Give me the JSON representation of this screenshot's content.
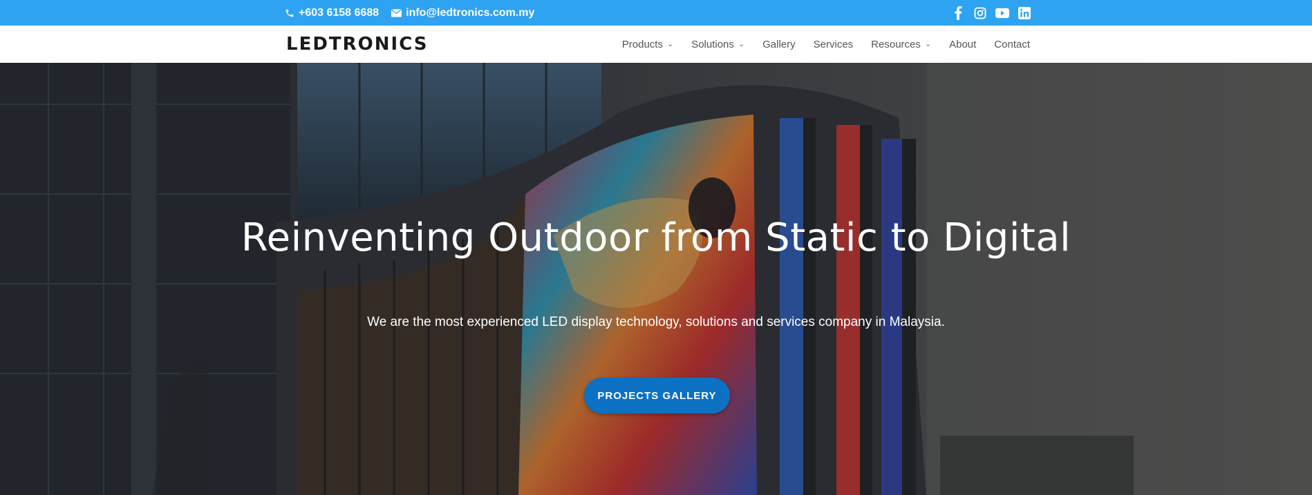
{
  "topbar": {
    "phone": "+603 6158 6688",
    "email": "info@ledtronics.com.my",
    "socials": [
      "facebook-icon",
      "instagram-icon",
      "youtube-icon",
      "linkedin-icon"
    ]
  },
  "header": {
    "logo_left": "LEDT",
    "logo_right": "RONICS",
    "nav": [
      {
        "label": "Products",
        "dropdown": true
      },
      {
        "label": "Solutions",
        "dropdown": true
      },
      {
        "label": "Gallery",
        "dropdown": false
      },
      {
        "label": "Services",
        "dropdown": false
      },
      {
        "label": "Resources",
        "dropdown": true
      },
      {
        "label": "About",
        "dropdown": false
      },
      {
        "label": "Contact",
        "dropdown": false
      }
    ]
  },
  "hero": {
    "title": "Reinventing Outdoor from Static to Digital",
    "subtitle": "We are the most experienced LED display technology, solutions and services company in Malaysia.",
    "cta_label": "PROJECTS GALLERY"
  },
  "colors": {
    "topbar": "#2ea3f2",
    "cta": "#0c71c3",
    "nav_text": "#555555"
  }
}
